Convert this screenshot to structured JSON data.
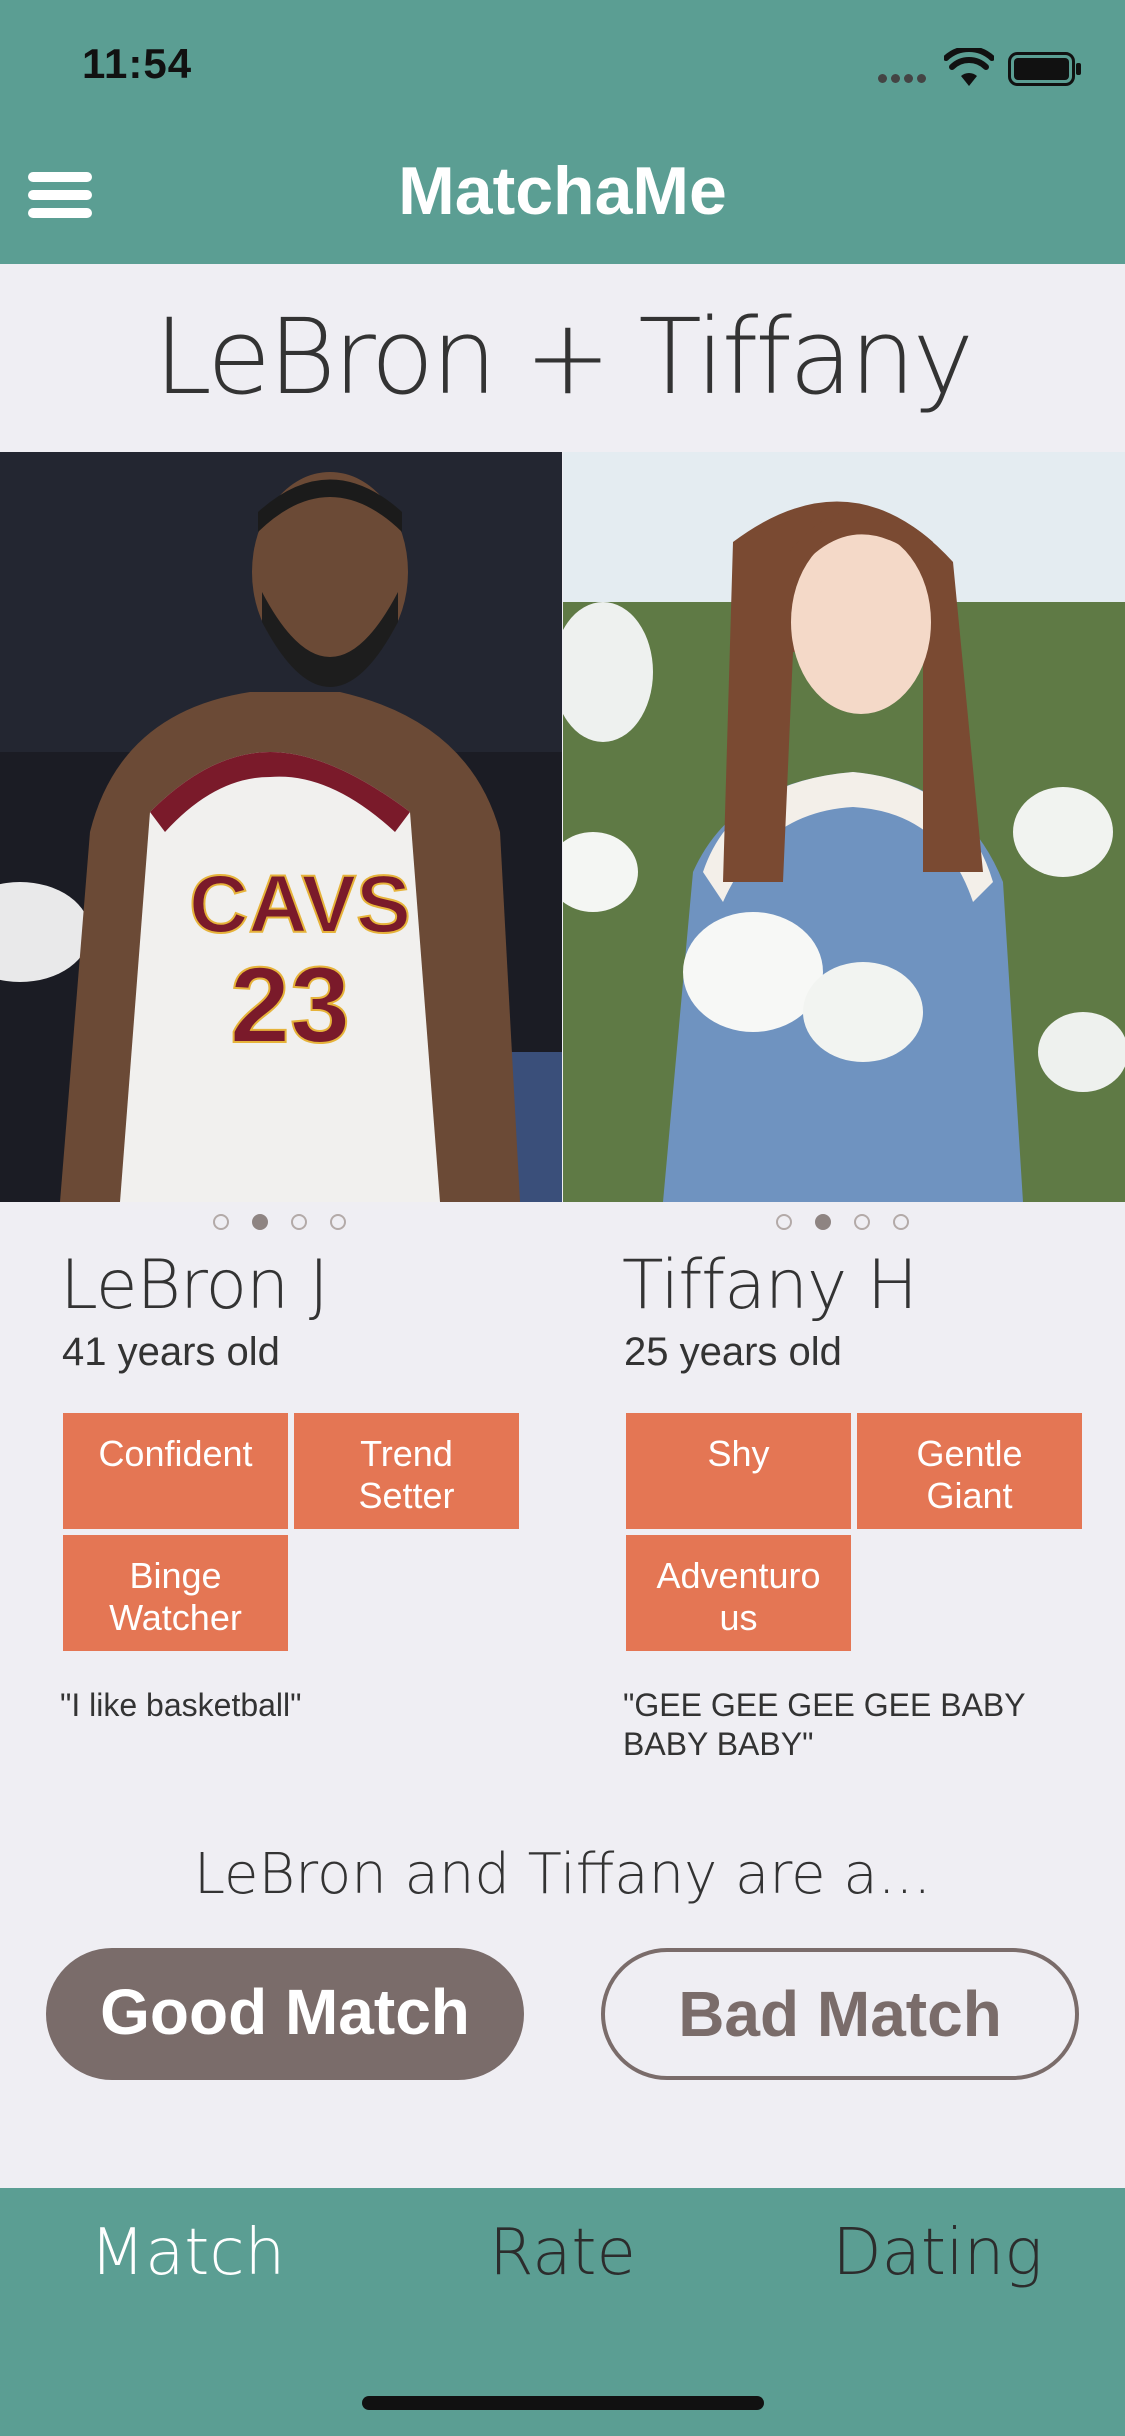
{
  "status_bar": {
    "time": "11:54"
  },
  "header": {
    "app_title": "MatchaMe"
  },
  "pair_title": "LeBron + Tiffany",
  "people": [
    {
      "name": "LeBron J",
      "age": "41 years old",
      "traits": [
        "Confident",
        "Trend\nSetter",
        "Binge\nWatcher"
      ],
      "quote": "\"I like basketball\"",
      "jersey_text": "CAVS",
      "jersey_number": "23",
      "active_photo": 2,
      "photo_count": 4
    },
    {
      "name": "Tiffany H",
      "age": "25 years old",
      "traits": [
        "Shy",
        "Gentle\nGiant",
        "Adventuro\nus"
      ],
      "quote": "\"GEE GEE GEE GEE BABY BABY BABY\"",
      "active_photo": 2,
      "photo_count": 4
    }
  ],
  "question": "LeBron and Tiffany are a...",
  "buttons": {
    "good": "Good Match",
    "bad": "Bad Match"
  },
  "tabs": [
    {
      "label": "Match",
      "active": true
    },
    {
      "label": "Rate",
      "active": false
    },
    {
      "label": "Dating",
      "active": false
    }
  ],
  "colors": {
    "primary": "#5b9e93",
    "trait": "#e47654",
    "button": "#7a6c6a",
    "background": "#efeef3"
  }
}
